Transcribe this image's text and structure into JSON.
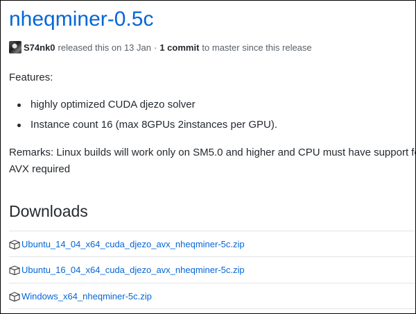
{
  "release": {
    "title": "nheqminer-0.5c",
    "author": "S74nk0",
    "released_text": "released this on 13 Jan",
    "separator": "·",
    "commits": "1 commit",
    "commits_suffix": "to master since this release"
  },
  "notes": {
    "features_label": "Features:",
    "bullets": [
      "highly optimized CUDA djezo solver",
      "Instance count 16 (max 8GPUs 2instances per GPU)."
    ],
    "remarks": "Remarks: Linux builds will work only on SM5.0 and higher and CPU must have support for AVX required"
  },
  "downloads": {
    "heading": "Downloads",
    "files": [
      "Ubuntu_14_04_x64_cuda_djezo_avx_nheqminer-5c.zip",
      "Ubuntu_16_04_x64_cuda_djezo_avx_nheqminer-5c.zip",
      "Windows_x64_nheqminer-5c.zip"
    ]
  },
  "colors": {
    "link": "#0366d6",
    "text": "#24292e",
    "muted": "#586069",
    "divider": "#e1e4e8"
  },
  "icons": {
    "file": "package-icon"
  }
}
